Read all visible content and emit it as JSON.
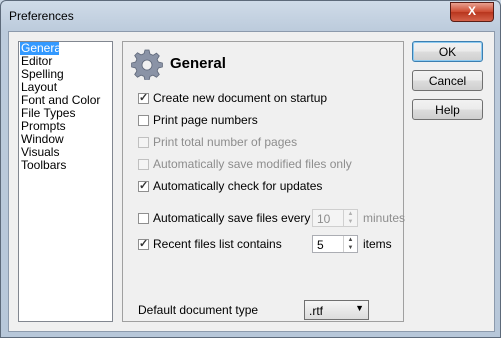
{
  "window": {
    "title": "Preferences",
    "close_label": "X"
  },
  "nav": {
    "items": [
      "General",
      "Editor",
      "Spelling",
      "Layout",
      "Font and Color",
      "File Types",
      "Prompts",
      "Window",
      "Visuals",
      "Toolbars"
    ],
    "selected": "General"
  },
  "panel": {
    "heading": "General",
    "icon": "gear-icon",
    "options": {
      "create_new": {
        "label": "Create new document on startup",
        "checked": true,
        "enabled": true
      },
      "print_page_numbers": {
        "label": "Print page numbers",
        "checked": false,
        "enabled": true
      },
      "print_total_pages": {
        "label": "Print total number of pages",
        "checked": false,
        "enabled": false
      },
      "auto_save_modified": {
        "label": "Automatically save modified files only",
        "checked": false,
        "enabled": false
      },
      "auto_check_updates": {
        "label": "Automatically check for updates",
        "checked": true,
        "enabled": true
      },
      "auto_save_every": {
        "label": "Automatically save files every",
        "checked": false,
        "enabled": true,
        "value": "10",
        "unit": "minutes"
      },
      "recent_files": {
        "label": "Recent files list contains",
        "checked": true,
        "enabled": true,
        "value": "5",
        "unit": "items"
      }
    },
    "default_type": {
      "label": "Default document type",
      "value": ".rtf"
    }
  },
  "buttons": {
    "ok": "OK",
    "cancel": "Cancel",
    "help": "Help"
  }
}
